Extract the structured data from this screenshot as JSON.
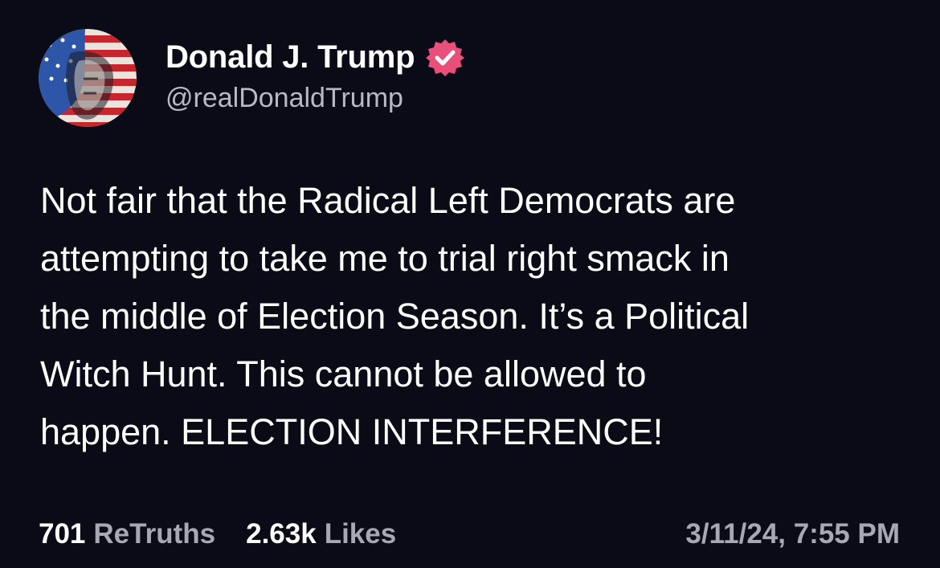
{
  "author": {
    "display_name": "Donald J. Trump",
    "handle": "@realDonaldTrump",
    "verified": true,
    "avatar_icon": "flag-portrait-avatar",
    "verified_icon": "verified-badge-icon",
    "verified_color": "#e8507a"
  },
  "post": {
    "lines": [
      "Not fair that the Radical Left Democrats are",
      "attempting to take me to trial right smack in",
      "the middle of Election Season. It’s a Political",
      "Witch Hunt. This cannot be allowed to",
      "happen. ELECTION INTERFERENCE!"
    ]
  },
  "stats": {
    "retruths_count": "701",
    "retruths_label": "ReTruths",
    "likes_count": "2.63k",
    "likes_label": "Likes"
  },
  "timestamp": "3/11/24, 7:55 PM",
  "colors": {
    "background": "#0b0a17",
    "text": "#ffffff",
    "muted": "#a8a7b3"
  }
}
